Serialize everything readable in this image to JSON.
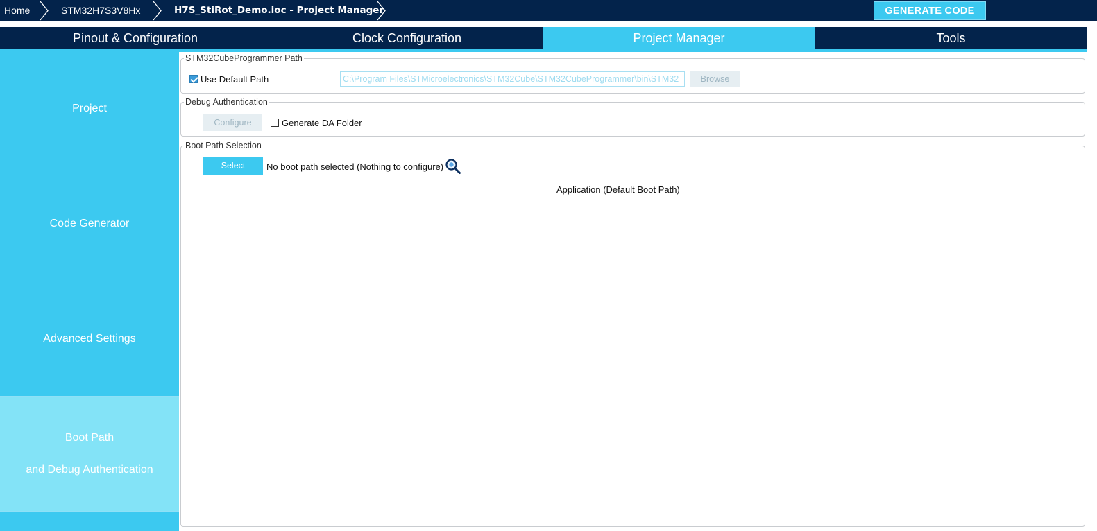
{
  "breadcrumb": {
    "home": "Home",
    "device": "STM32H7S3V8Hx",
    "file": "H7S_StiRot_Demo.ioc - Project Manager"
  },
  "generate_button": "GENERATE CODE",
  "tabs": [
    {
      "label": "Pinout & Configuration",
      "active": false
    },
    {
      "label": "Clock Configuration",
      "active": false
    },
    {
      "label": "Project Manager",
      "active": true
    },
    {
      "label": "Tools",
      "active": false
    }
  ],
  "sidebar": {
    "items": [
      {
        "label": "Project",
        "active": false
      },
      {
        "label": "Code Generator",
        "active": false
      },
      {
        "label": "Advanced Settings",
        "active": false
      },
      {
        "label": "Boot Path",
        "label2": "and Debug Authentication",
        "active": true
      }
    ]
  },
  "programmer_group": {
    "legend": "STM32CubeProgrammer Path",
    "use_default_label": "Use Default Path",
    "use_default_checked": true,
    "path_value": "C:\\Program Files\\STMicroelectronics\\STM32Cube\\STM32CubeProgrammer\\bin\\STM32",
    "browse_label": "Browse"
  },
  "debug_group": {
    "legend": "Debug Authentication",
    "configure_label": "Configure",
    "generate_da_label": "Generate DA Folder",
    "generate_da_checked": false
  },
  "boot_group": {
    "legend": "Boot Path Selection",
    "select_label": "Select",
    "status_text": "No boot path selected (Nothing to configure)",
    "default_text": "Application (Default Boot Path)"
  },
  "colors": {
    "navy": "#03234b",
    "accent": "#3cc9f0",
    "active_sidebar": "#83e3f7"
  }
}
